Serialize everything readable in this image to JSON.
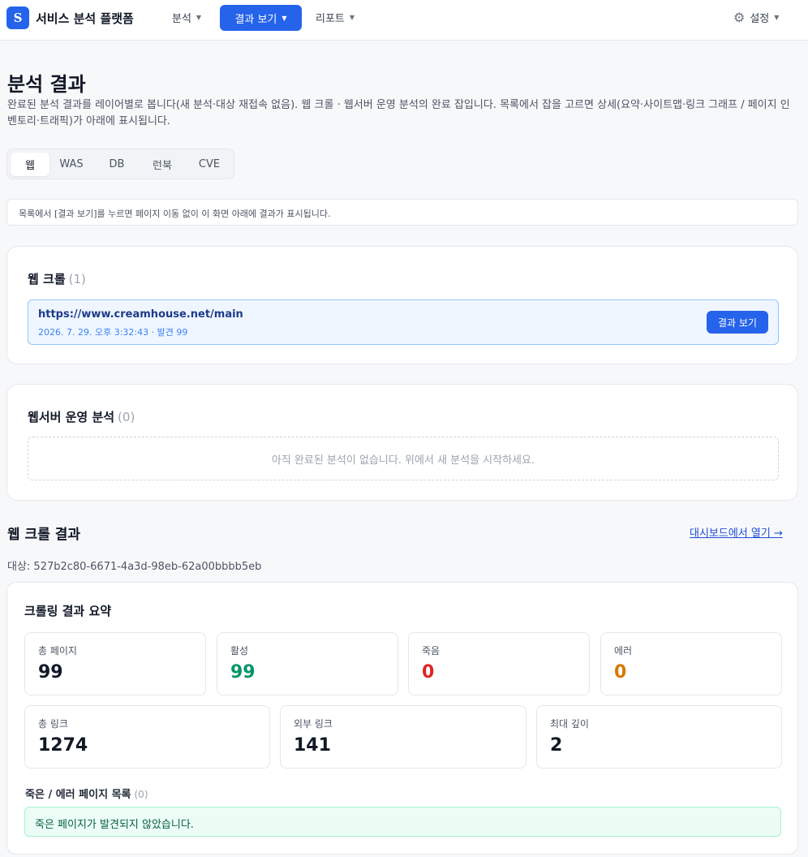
{
  "app": {
    "logo_letter": "S",
    "name": "서비스 분석 플랫폼"
  },
  "nav": {
    "items": [
      {
        "label": "분석"
      },
      {
        "label": "결과 보기"
      },
      {
        "label": "리포트"
      }
    ],
    "caret": "▼",
    "settings_label": "설정",
    "gear_glyph": "⚙"
  },
  "page": {
    "title": "분석 결과",
    "description": "완료된 분석 결과를 레이어별로 봅니다(새 분석·대상 재접속 없음). 웹 크롤 · 웹서버 운영 분석의 완료 잡입니다. 목록에서 잡을 고르면 상세(요약·사이트맵·링크 그래프 / 페이지 인벤토리·트래픽)가 아래에 표시됩니다."
  },
  "tabs": [
    {
      "label": "웹",
      "active": true
    },
    {
      "label": "WAS",
      "active": false
    },
    {
      "label": "DB",
      "active": false
    },
    {
      "label": "런북",
      "active": false
    },
    {
      "label": "CVE",
      "active": false
    }
  ],
  "notice": "목록에서 [결과 보기]를 누르면 페이지 이동 없이 이 화면 아래에 결과가 표시됩니다.",
  "web_crawl_card": {
    "title": "웹 크롤",
    "count": "(1)",
    "job": {
      "url": "https://www.creamhouse.net/main",
      "meta": "2026. 7. 29. 오후 3:32:43 · 발견 99",
      "button_label": "결과 보기"
    }
  },
  "webserver_card": {
    "title": "웹서버 운영 분석",
    "count": "(0)",
    "empty_text": "아직 완료된 분석이 없습니다. 위에서 새 분석을 시작하세요."
  },
  "results": {
    "title": "웹 크롤 결과",
    "dashboard_link": "대시보드에서 열기 →",
    "target": "대상: 527b2c80-6671-4a3d-98eb-62a00bbbb5eb",
    "summary_title": "크롤링 결과 요약",
    "stats_row1": [
      {
        "label": "총 페이지",
        "value": "99",
        "color": "#111827"
      },
      {
        "label": "활성",
        "value": "99",
        "color": "#059669"
      },
      {
        "label": "죽음",
        "value": "0",
        "color": "#dc2626"
      },
      {
        "label": "에러",
        "value": "0",
        "color": "#d97706"
      }
    ],
    "stats_row2": [
      {
        "label": "총 링크",
        "value": "1274",
        "color": "#111827"
      },
      {
        "label": "외부 링크",
        "value": "141",
        "color": "#111827"
      },
      {
        "label": "최대 깊이",
        "value": "2",
        "color": "#111827"
      }
    ],
    "dead_list_title": "죽은 / 에러 페이지 목록",
    "dead_list_count": "(0)",
    "dead_list_empty": "죽은 페이지가 발견되지 않았습니다."
  }
}
